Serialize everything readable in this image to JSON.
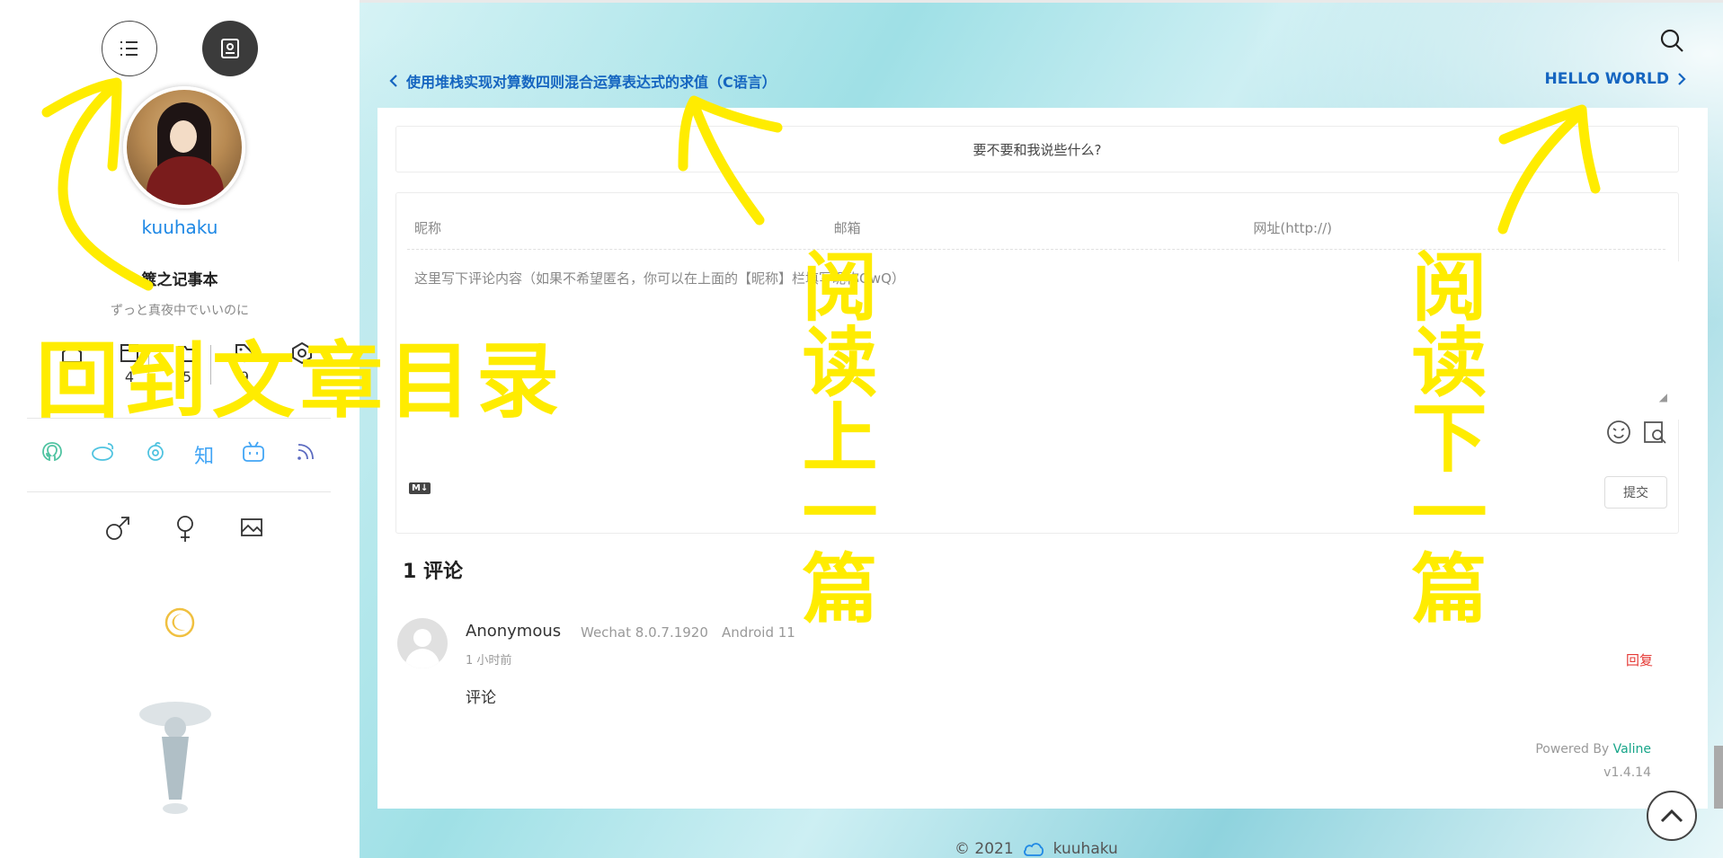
{
  "sidebar": {
    "username": "kuuhaku",
    "blog_title": "箧之记事本",
    "subtitle": "ずっと真夜中でいいのに",
    "stats": [
      {
        "icon": "home-icon",
        "count": ""
      },
      {
        "icon": "archive-icon",
        "count": "4"
      },
      {
        "icon": "folder-icon",
        "count": "5"
      },
      {
        "icon": "tag-icon",
        "count": "9"
      },
      {
        "icon": "settings-icon",
        "count": ""
      }
    ],
    "social": [
      {
        "icon": "github-icon",
        "glyph": "",
        "color": "#4fc3a1"
      },
      {
        "icon": "weibo-icon",
        "glyph": "",
        "color": "#4fc3e0"
      },
      {
        "icon": "netease-music-icon",
        "glyph": "",
        "color": "#4fc3e0"
      },
      {
        "icon": "zhihu-icon",
        "glyph": "知",
        "color": "#42a5f5"
      },
      {
        "icon": "bilibili-icon",
        "glyph": "",
        "color": "#42a5f5"
      },
      {
        "icon": "rss-icon",
        "glyph": "",
        "color": "#5c6bc0"
      }
    ],
    "extras": [
      "male-icon",
      "female-icon",
      "image-icon"
    ]
  },
  "nav": {
    "prev_title": "使用堆栈实现对算数四则混合运算表达式的求值（C语言）",
    "next_title": "HELLO WORLD"
  },
  "comment_form": {
    "prompt": "要不要和我说些什么?",
    "nickname_placeholder": "昵称",
    "email_placeholder": "邮箱",
    "url_placeholder": "网址(http://)",
    "content_placeholder": "这里写下评论内容（如果不希望匿名，你可以在上面的【昵称】栏填写昵称QwQ）",
    "md_badge": "M↓",
    "submit_label": "提交"
  },
  "comments": {
    "count_title": "1 评论",
    "items": [
      {
        "name": "Anonymous",
        "browser": "Wechat 8.0.7.1920",
        "os": "Android 11",
        "time": "1 小时前",
        "reply_label": "回复",
        "text": "评论"
      }
    ]
  },
  "powered": {
    "prefix": "Powered By ",
    "name": "Valine",
    "version": "v1.4.14"
  },
  "footer": {
    "copyright": "© 2021",
    "owner": "kuuhaku"
  },
  "annotations": {
    "toc_label": "回到文章目录",
    "prev_label": "阅读上一篇",
    "next_label": "阅读下一篇",
    "color": "#ffec00"
  }
}
